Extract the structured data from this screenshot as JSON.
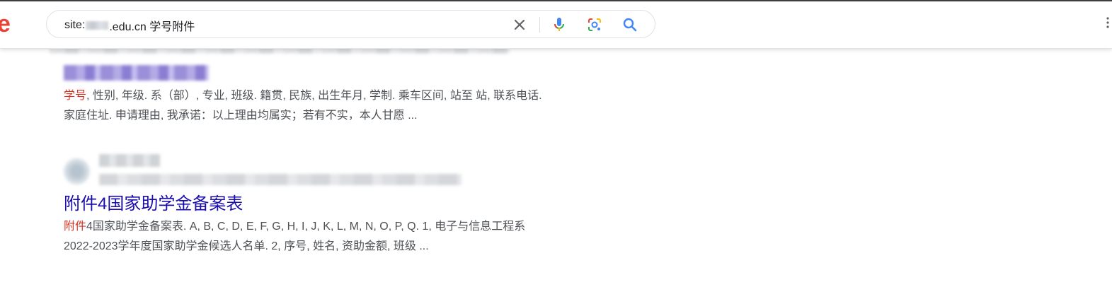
{
  "search": {
    "query_prefix": "site:",
    "query_suffix": ".edu.cn 学号附件"
  },
  "icons": {
    "clear": "close-icon",
    "voice": "microphone-icon",
    "image_search": "lens-icon",
    "search": "search-icon"
  },
  "colors": {
    "link": "#1a0dab",
    "highlight": "#d93025",
    "snippet_text": "#4d5156"
  },
  "results": [
    {
      "snippet_line1_highlight": "学号",
      "snippet_line1_rest": ", 性别, 年级. 系（部）, 专业, 班级. 籍贯, 民族, 出生年月, 学制. 乘车区间, 站至 站, 联系电话.",
      "snippet_line2": "家庭住址. 申请理由, 我承诺：以上理由均属实；若有不实，本人甘愿 ..."
    },
    {
      "title": "附件4国家助学金备案表",
      "snippet_line1_highlight": "附件",
      "snippet_line1_rest": "4国家助学金备案表. A, B, C, D, E, F, G, H, I, J, K, L, M, N, O, P, Q. 1, 电子与信息工程系",
      "snippet_line2": "2022-2023学年度国家助学金候选人名单. 2, 序号, 姓名, 资助金额, 班级 ..."
    }
  ]
}
